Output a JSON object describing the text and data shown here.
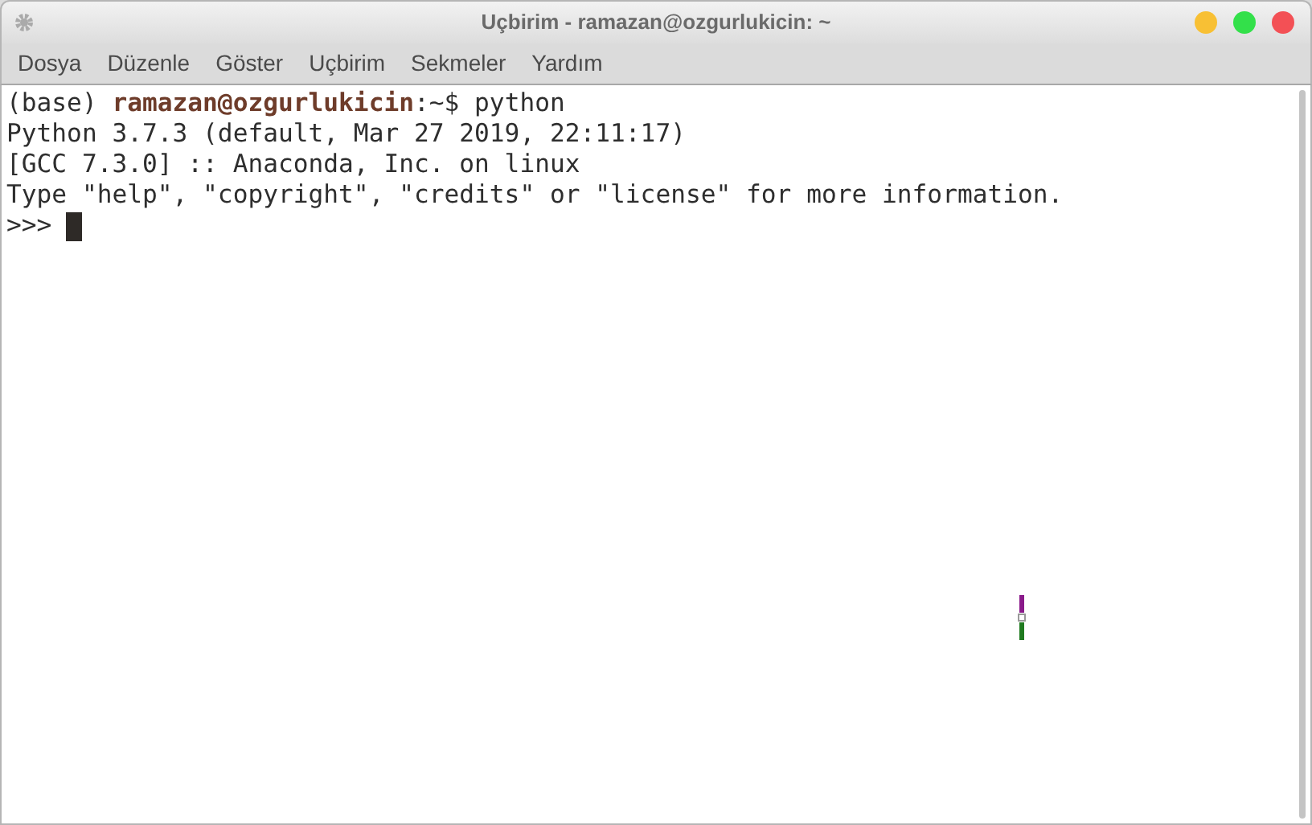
{
  "window": {
    "title": "Uçbirim - ramazan@ozgurlukicin: ~"
  },
  "menu": [
    "Dosya",
    "Düzenle",
    "Göster",
    "Uçbirim",
    "Sekmeler",
    "Yardım"
  ],
  "terminal": {
    "lines": [
      {
        "kind": "prompt",
        "env": "(base)",
        "user": "ramazan@ozgurlukicin",
        "suffix": ":~$",
        "command": "python"
      },
      {
        "kind": "output",
        "text": "Python 3.7.3 (default, Mar 27 2019, 22:11:17)"
      },
      {
        "kind": "output",
        "text": "[GCC 7.3.0] :: Anaconda, Inc. on linux"
      },
      {
        "kind": "output",
        "text": "Type \"help\", \"copyright\", \"credits\" or \"license\" for more information."
      },
      {
        "kind": "repl",
        "text": ">>>"
      }
    ]
  }
}
